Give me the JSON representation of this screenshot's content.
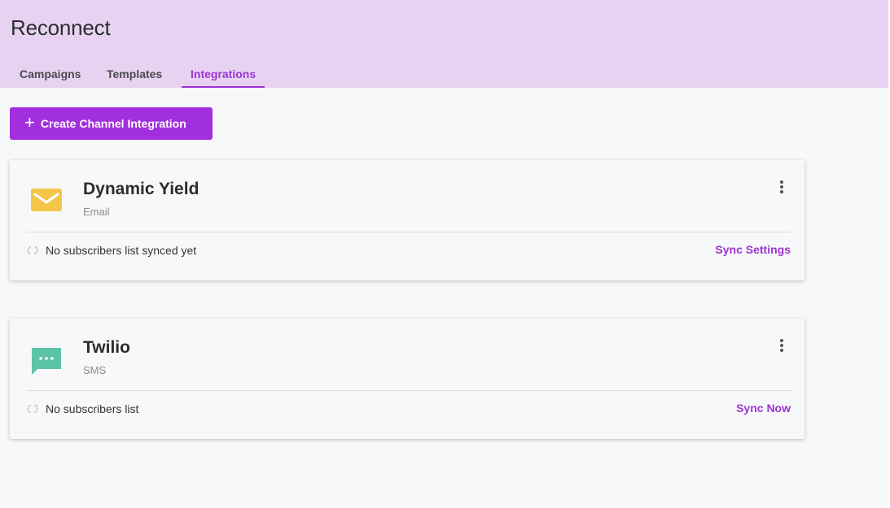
{
  "app": {
    "title": "Reconnect"
  },
  "tabs": [
    {
      "label": "Campaigns",
      "active": false
    },
    {
      "label": "Templates",
      "active": false
    },
    {
      "label": "Integrations",
      "active": true
    }
  ],
  "create_button": {
    "label": "Create Channel Integration",
    "icon": "plus-icon"
  },
  "colors": {
    "accent": "#9b34d0",
    "header_bg": "#e7d3f1",
    "email_icon": "#f5c54a",
    "sms_icon": "#5bc4a5"
  },
  "integrations": [
    {
      "name": "Dynamic Yield",
      "channel": "Email",
      "icon": "email-icon",
      "status": "No subscribers list synced yet",
      "action": "Sync Settings"
    },
    {
      "name": "Twilio",
      "channel": "SMS",
      "icon": "sms-icon",
      "status": "No subscribers list",
      "action": "Sync Now"
    }
  ]
}
